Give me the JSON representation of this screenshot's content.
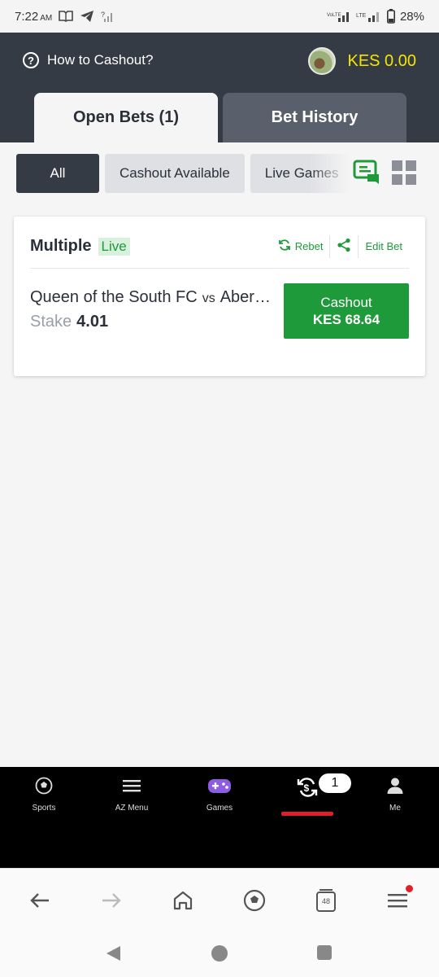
{
  "status_bar": {
    "time": "7:22",
    "ampm": "AM",
    "battery": "28%"
  },
  "header": {
    "how_to": "How to Cashout?",
    "balance": "KES 0.00",
    "tabs": [
      {
        "label": "Open Bets (1)",
        "active": true
      },
      {
        "label": "Bet History",
        "active": false
      }
    ]
  },
  "filters": {
    "chips": [
      "All",
      "Cashout Available",
      "Live Games"
    ]
  },
  "bet": {
    "type": "Multiple",
    "status": "Live",
    "actions": {
      "rebet": "Rebet",
      "edit": "Edit Bet"
    },
    "home": "Queen of the South FC",
    "vs": "vs",
    "away": "Aberdeen",
    "stake_label": "Stake",
    "stake_value": "4.01",
    "cashout_label": "Cashout",
    "cashout_amount": "KES 68.64"
  },
  "bottom_nav": {
    "items": [
      "Sports",
      "AZ Menu",
      "Games",
      "",
      "Me"
    ],
    "badge": "1"
  },
  "browser": {
    "tab_count": "48"
  },
  "colors": {
    "header": "#353b45",
    "accent_green": "#1e9a3a",
    "balance_yellow": "#f4e600",
    "active_red": "#e41e26"
  }
}
